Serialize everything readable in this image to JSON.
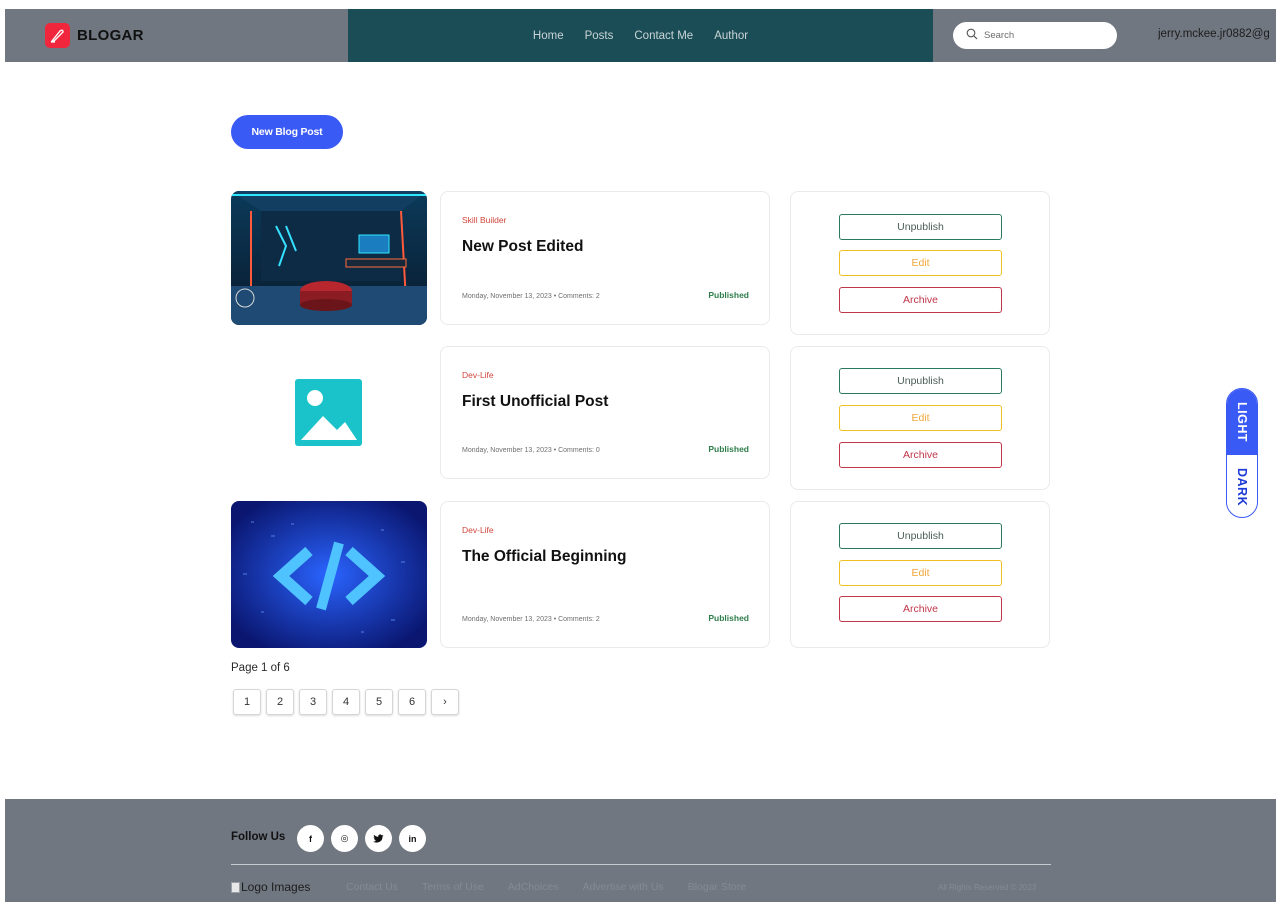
{
  "header": {
    "brand": "BLOGAR",
    "nav": [
      "Home",
      "Posts",
      "Contact Me",
      "Author"
    ],
    "search_placeholder": "Search",
    "user": "jerry.mckee.jr0882@g"
  },
  "main": {
    "new_post_label": "New Blog Post",
    "posts": [
      {
        "category": "Skill Builder",
        "title": "New Post Edited",
        "meta": "Monday, November 13, 2023  •  Comments: 2",
        "status": "Published",
        "thumbnail": "gaming-room-image"
      },
      {
        "category": "Dev-Life",
        "title": "First Unofficial Post",
        "meta": "Monday, November 13, 2023  •  Comments: 0",
        "status": "Published",
        "thumbnail": "image-placeholder-icon"
      },
      {
        "category": "Dev-Life",
        "title": "The Official Beginning",
        "meta": "Monday, November 13, 2023  •  Comments: 2",
        "status": "Published",
        "thumbnail": "code-tag-image"
      }
    ],
    "actions": {
      "unpublish": "Unpublish",
      "edit": "Edit",
      "archive": "Archive"
    },
    "pagination": {
      "label": "Page 1 of 6",
      "pages": [
        "1",
        "2",
        "3",
        "4",
        "5",
        "6"
      ],
      "next": "›"
    }
  },
  "theme_switch": {
    "light": "LIGHT",
    "dark": "DARK",
    "active": "light"
  },
  "footer": {
    "follow_label": "Follow Us",
    "socials": [
      "f",
      "◎",
      "🐦",
      "in"
    ],
    "logo_alt": "Logo Images",
    "links": [
      "Contact Us",
      "Terms of Use",
      "AdChoices",
      "Advertise with Us",
      "Blogar Store"
    ],
    "copyright": "All Rights Reserved © 2023"
  },
  "colors": {
    "header_bg": "#707780",
    "nav_bg": "#1b4d57",
    "accent": "#3a5af5",
    "brand_red": "#f0263d",
    "published": "#2e7d4a"
  }
}
